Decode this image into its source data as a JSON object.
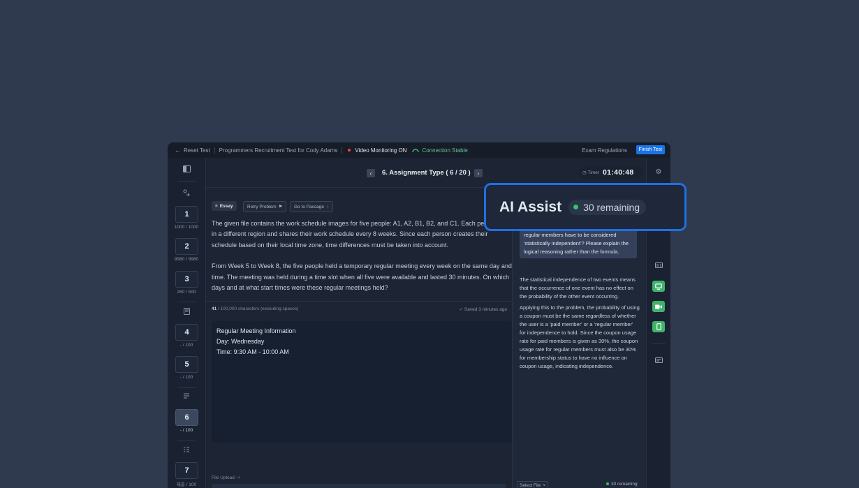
{
  "topbar": {
    "reset_label": "Reset Test",
    "test_title": "Programmers Recruitment Test for Cody Adams",
    "video_label": "Video Monitoring ON",
    "connection_label": "Connection Stable",
    "exam_regulations": "Exam Regulations",
    "finish_label": "Finish Test"
  },
  "sidebar": {
    "questions": [
      {
        "num": "1",
        "score": "1000 / 1000"
      },
      {
        "num": "2",
        "score": "9980 / 9980"
      },
      {
        "num": "3",
        "score": "250 / 500"
      },
      {
        "num": "4",
        "score": "- / 100"
      },
      {
        "num": "5",
        "score": "- / 100"
      },
      {
        "num": "6",
        "score": "- / 100"
      },
      {
        "num": "7",
        "score": "제출 / 100"
      }
    ]
  },
  "header": {
    "title": "6. Assignment Type ( 6 / 20 )",
    "timer_label": "Timer",
    "timer_value": "01:40:48"
  },
  "problem": {
    "type_tag": "Essay",
    "retry_label": "Retry Problem",
    "passage_label": "Go to Passage",
    "paragraph1": "The given file contains the work schedule images for five people: A1, A2, B1, B2, and C1. Each person lives in a different region and shares their work schedule every 8 weeks. Since each person creates their schedule based on their local time zone, time differences must be taken into account.",
    "paragraph2": "From Week 5 to Week 8, the five people held a temporary regular meeting every week on the same day and time. The meeting was held during a time slot when all five were available and lasted 30 minutes. On which days and at what start times were these regular meetings held?"
  },
  "answer": {
    "char_count": "41",
    "char_limit": "/ 100,000 characters (excluding spaces)",
    "saved_label": "Saved 3 minutes ago",
    "lines": [
      "Regular Meeting Information",
      "Day: Wednesday",
      "Time: 9:30 AM - 10:00 AM"
    ]
  },
  "file_upload": {
    "label": "File Upload"
  },
  "ai_panel": {
    "question_text": "regular members have to be considered 'statistically independent'? Please explain the logical reasoning rather than the formula.",
    "reply1": "The statistical independence of two events means that the occurrence of one event has no effect on the probability of the other event occurring.",
    "reply2": "Applying this to the problem, the probability of using a coupon must be the same regardless of whether the user is a 'paid member' or a 'regular member' for independence to hold. Since the coupon usage rate for paid members is given as 30%, the coupon usage rate for regular members must also be 30% for membership status to have no influence on coupon usage, indicating independence.",
    "select_file": "Select File",
    "remaining": "30 remaining"
  },
  "popup": {
    "title": "AI Assist",
    "remaining": "30 remaining"
  },
  "colors": {
    "background": "#303a4f",
    "accent": "#1f6fe5",
    "success": "#37c264",
    "recording": "#e5484d"
  }
}
